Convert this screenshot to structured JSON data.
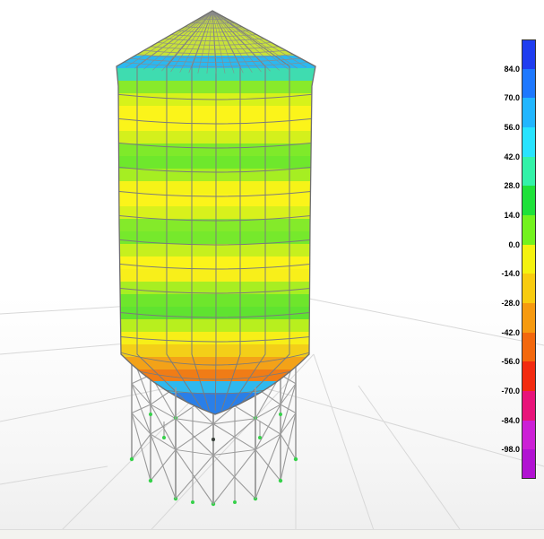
{
  "legend": {
    "labels": [
      "84.0",
      "70.0",
      "56.0",
      "42.0",
      "28.0",
      "14.0",
      "0.0",
      "-14.0",
      "-28.0",
      "-42.0",
      "-56.0",
      "-70.0",
      "-84.0",
      "-98.0"
    ],
    "colors": [
      "#1f3df0",
      "#1e78ff",
      "#22b6ff",
      "#28e3ff",
      "#33f2a8",
      "#1fe13a",
      "#73f21e",
      "#f4f210",
      "#f8cc10",
      "#f69a10",
      "#f3680d",
      "#f22b10",
      "#e8147a",
      "#cc20d6",
      "#b112d2"
    ]
  },
  "model": {
    "band_colors": [
      "#2bb8f0",
      "#3fdcb0",
      "#88ea2b",
      "#d7f21a",
      "#fbf41a",
      "#fbf41a",
      "#d4f01c",
      "#7fea2a",
      "#6ee82c",
      "#a6ee22",
      "#f6f318",
      "#fbf41a",
      "#d8f11c",
      "#84ea2a",
      "#76e92c",
      "#c6f01e",
      "#fbf41a",
      "#f8ef1a",
      "#a8ee22",
      "#6ee62c",
      "#5fe330",
      "#b8ef1e",
      "#f7ef18",
      "#f3cf18",
      "#f3a218",
      "#f07c16",
      "#e85e14"
    ],
    "node_color": "#36d14a",
    "frame_color": "#9a9a9a"
  }
}
